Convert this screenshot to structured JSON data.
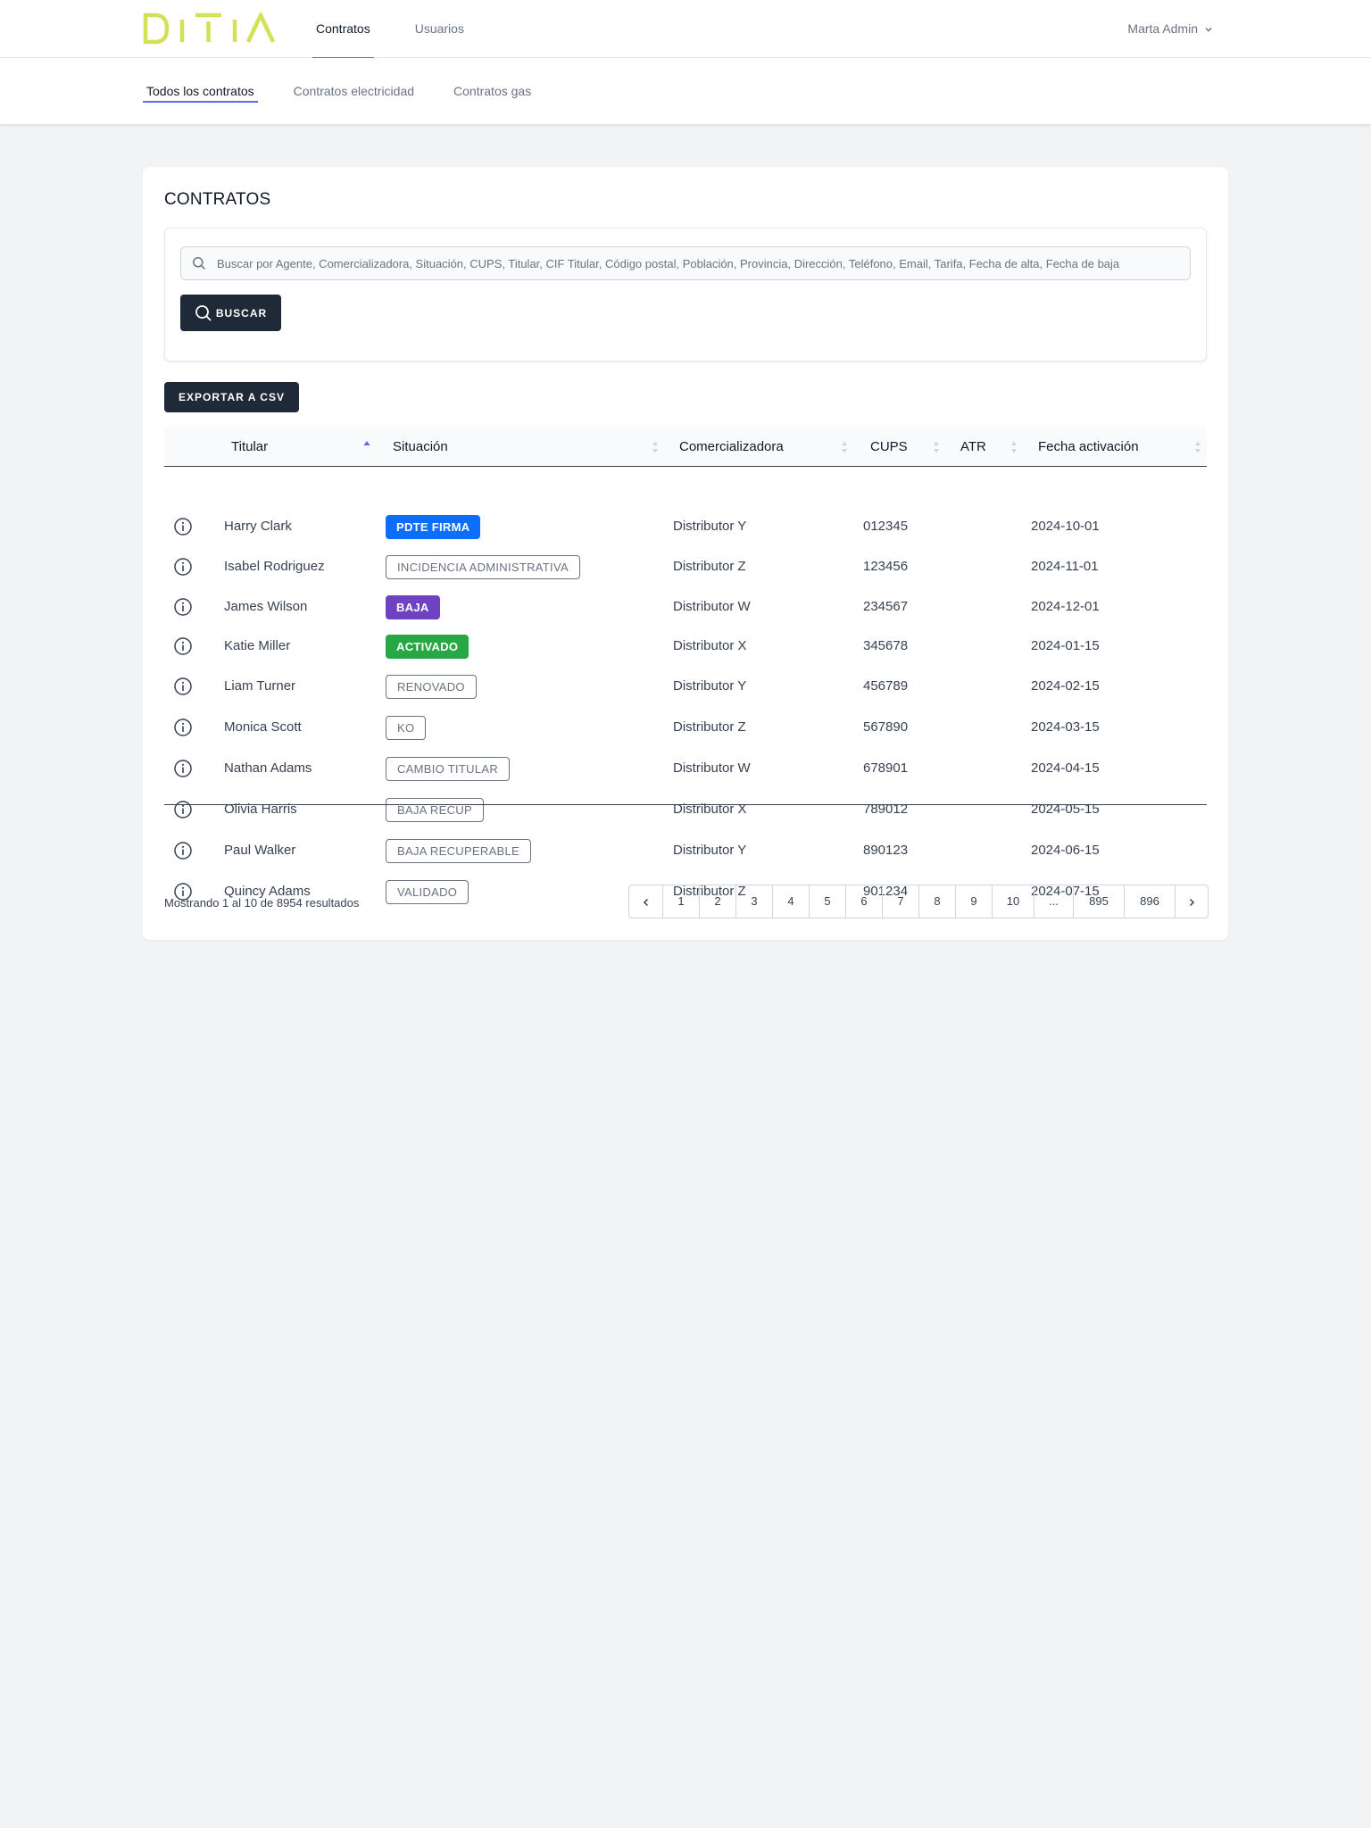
{
  "brand": {
    "logo_text": "DITIA",
    "logo_color": "#d4e157"
  },
  "topnav": {
    "items": [
      {
        "label": "Contratos",
        "active": true
      },
      {
        "label": "Usuarios",
        "active": false
      }
    ],
    "user": "Marta Admin"
  },
  "subnav": {
    "tabs": [
      {
        "label": "Todos los contratos",
        "active": true
      },
      {
        "label": "Contratos electricidad",
        "active": false
      },
      {
        "label": "Contratos gas",
        "active": false
      }
    ]
  },
  "page": {
    "title": "CONTRATOS",
    "search_placeholder": "Buscar por Agente, Comercializadora, Situación, CUPS, Titular, CIF Titular, Código postal, Población, Provincia, Dirección, Teléfono, Email, Tarifa, Fecha de alta, Fecha de baja",
    "search_button": "BUSCAR",
    "export_button": "EXPORTAR A CSV"
  },
  "table": {
    "columns": [
      "Titular",
      "Situación",
      "Comercializadora",
      "CUPS",
      "ATR",
      "Fecha activación"
    ],
    "rows": [
      {
        "titular": "Harry Clark",
        "situacion": "PDTE FIRMA",
        "style": "solid",
        "color": "#0d6efd",
        "comercializadora": "Distributor Y",
        "cups": "012345",
        "atr": "",
        "fecha": "2024-10-01"
      },
      {
        "titular": "Isabel Rodriguez",
        "situacion": "INCIDENCIA ADMINISTRATIVA",
        "style": "outline",
        "color": "#6b7280",
        "comercializadora": "Distributor Z",
        "cups": "123456",
        "atr": "",
        "fecha": "2024-11-01"
      },
      {
        "titular": "James Wilson",
        "situacion": "BAJA",
        "style": "solid",
        "color": "#6f42c1",
        "comercializadora": "Distributor W",
        "cups": "234567",
        "atr": "",
        "fecha": "2024-12-01"
      },
      {
        "titular": "Katie Miller",
        "situacion": "ACTIVADO",
        "style": "solid",
        "color": "#28a745",
        "comercializadora": "Distributor X",
        "cups": "345678",
        "atr": "",
        "fecha": "2024-01-15"
      },
      {
        "titular": "Liam Turner",
        "situacion": "RENOVADO",
        "style": "outline",
        "color": "#6b7280",
        "comercializadora": "Distributor Y",
        "cups": "456789",
        "atr": "",
        "fecha": "2024-02-15"
      },
      {
        "titular": "Monica Scott",
        "situacion": "KO",
        "style": "outline",
        "color": "#6b7280",
        "comercializadora": "Distributor Z",
        "cups": "567890",
        "atr": "",
        "fecha": "2024-03-15"
      },
      {
        "titular": "Nathan Adams",
        "situacion": "CAMBIO TITULAR",
        "style": "outline",
        "color": "#6b7280",
        "comercializadora": "Distributor W",
        "cups": "678901",
        "atr": "",
        "fecha": "2024-04-15"
      },
      {
        "titular": "Olivia Harris",
        "situacion": "BAJA RECUP",
        "style": "outline",
        "color": "#6b7280",
        "comercializadora": "Distributor X",
        "cups": "789012",
        "atr": "",
        "fecha": "2024-05-15"
      },
      {
        "titular": "Paul Walker",
        "situacion": "BAJA RECUPERABLE",
        "style": "outline",
        "color": "#6b7280",
        "comercializadora": "Distributor Y",
        "cups": "890123",
        "atr": "",
        "fecha": "2024-06-15"
      },
      {
        "titular": "Quincy Adams",
        "situacion": "VALIDADO",
        "style": "outline",
        "color": "#6b7280",
        "comercializadora": "Distributor Z",
        "cups": "901234",
        "atr": "",
        "fecha": "2024-07-15"
      }
    ]
  },
  "footer": {
    "results_prefix": "Mostrando",
    "from": "1",
    "sep_al": "al",
    "to": "10",
    "sep_de": "de",
    "total": "8954",
    "suffix": "resultados"
  },
  "pagination": {
    "pages": [
      "1",
      "2",
      "3",
      "4",
      "5",
      "6",
      "7",
      "8",
      "9",
      "10",
      "...",
      "895",
      "896"
    ]
  },
  "colors": {
    "accent": "#6366f1",
    "dark": "#1f2937"
  }
}
